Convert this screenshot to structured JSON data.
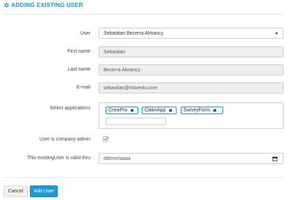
{
  "header": {
    "title": "ADDING EXISTING USER",
    "icon": "gear-icon",
    "accent": "#1a9bd7"
  },
  "form": {
    "user": {
      "label": "User",
      "value": "Sebastian Becerra Almancy"
    },
    "first_name": {
      "label": "First name",
      "value": "Sebastian"
    },
    "last_name": {
      "label": "Last name",
      "value": "Becerra Almancy"
    },
    "email": {
      "label": "E-mail",
      "value": "sebastian@move4u.com"
    },
    "applications": {
      "label": "Select applications",
      "selected": [
        "CrewPro",
        "ClaimApp",
        "SurveyForm"
      ],
      "remove_glyph": "✖"
    },
    "company_admin": {
      "label": "User is company admin",
      "checked": true
    },
    "valid_thru": {
      "label": "This existingUser is valid thru",
      "placeholder": "dd/mm/aaaa"
    }
  },
  "buttons": {
    "cancel": "Cancel",
    "add": "Add User"
  }
}
